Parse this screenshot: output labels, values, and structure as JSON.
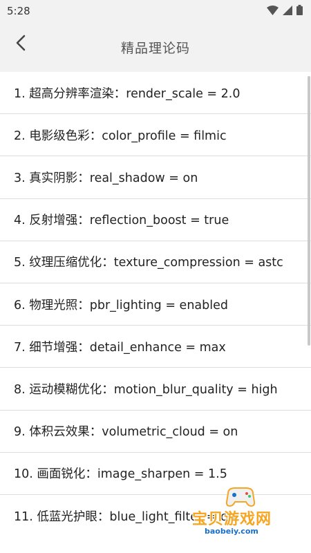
{
  "status_bar": {
    "time": "5:28",
    "icons": [
      "wifi-icon",
      "cell-signal-icon",
      "battery-icon"
    ]
  },
  "header": {
    "back_icon": "chevron-left-icon",
    "title": "精品理论码"
  },
  "list": {
    "items": [
      "1. 超高分辨率渲染：render_scale = 2.0",
      "2. 电影级色彩：color_profile = filmic",
      "3. 真实阴影：real_shadow = on",
      "4. 反射增强：reflection_boost = true",
      "5. 纹理压缩优化：texture_compression = astc",
      "6. 物理光照：pbr_lighting = enabled",
      "7. 细节增强：detail_enhance = max",
      "8. 运动模糊优化：motion_blur_quality = high",
      "9. 体积云效果：volumetric_cloud = on",
      "10. 画面锐化：image_sharpen = 1.5",
      "11. 低蓝光护眼：blue_light_filter = on"
    ]
  },
  "watermark": {
    "text": "宝贝游戏网",
    "url": "baobeiy.com"
  },
  "colors": {
    "header_bg": "#f2f2f2",
    "divider": "#dcdcdc",
    "text": "#222222",
    "watermark": "#f5a623"
  }
}
